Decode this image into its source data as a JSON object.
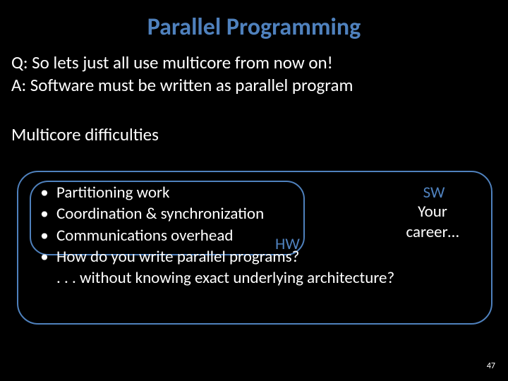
{
  "title": "Parallel Programming",
  "qa": {
    "q": "Q: So lets just all use multicore from now on!",
    "a": "A: Software must be written as parallel program"
  },
  "mc_heading": "Multicore difficulties",
  "bullets": {
    "b1": "Partitioning work",
    "b2": "Coordination & synchronization",
    "b3": "Communications overhead",
    "b4": "How do you write parallel programs?",
    "b4_cont": ". . . without knowing exact underlying architecture?"
  },
  "labels": {
    "hw": "HW",
    "sw": "SW"
  },
  "career": {
    "line1": "Your",
    "line2": "career…"
  },
  "pagenum": "47"
}
